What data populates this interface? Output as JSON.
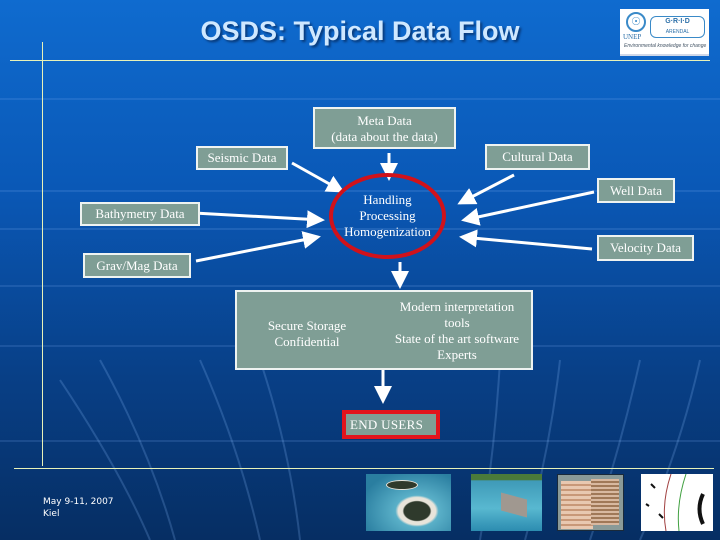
{
  "slide": {
    "title": "OSDS: Typical Data Flow",
    "logo": {
      "org_left": "UNEP",
      "org_right": "G·R·I·D",
      "org_right_sub": "ARENDAL",
      "tagline": "Environmental knowledge for change"
    },
    "diagram": {
      "center_node": [
        "Handling",
        "Processing",
        "Homogenization"
      ],
      "meta_data": [
        "Meta Data",
        "(data about the data)"
      ],
      "sources": {
        "seismic": "Seismic Data",
        "cultural": "Cultural Data",
        "bathymetry": "Bathymetry Data",
        "well": "Well Data",
        "gravmag": "Grav/Mag Data",
        "velocity": "Velocity Data"
      },
      "storage": [
        "Secure Storage",
        "Confidential"
      ],
      "tools": [
        "Modern interpretation",
        "tools",
        "State of the art software",
        "Experts"
      ],
      "end_users": "END USERS"
    },
    "footer": {
      "date": "May 9-11, 2007",
      "location": "Kiel"
    },
    "thumbnails": [
      {
        "name": "atoll-aerial-photo"
      },
      {
        "name": "seafloor-3d-render"
      },
      {
        "name": "seismic-section-cube"
      },
      {
        "name": "contour-map"
      }
    ],
    "colors": {
      "box_fill": "#7f9e95",
      "highlight_red": "#d0121b",
      "title_text": "#cfe8ff",
      "rule_line": "#e8f2b8"
    }
  }
}
